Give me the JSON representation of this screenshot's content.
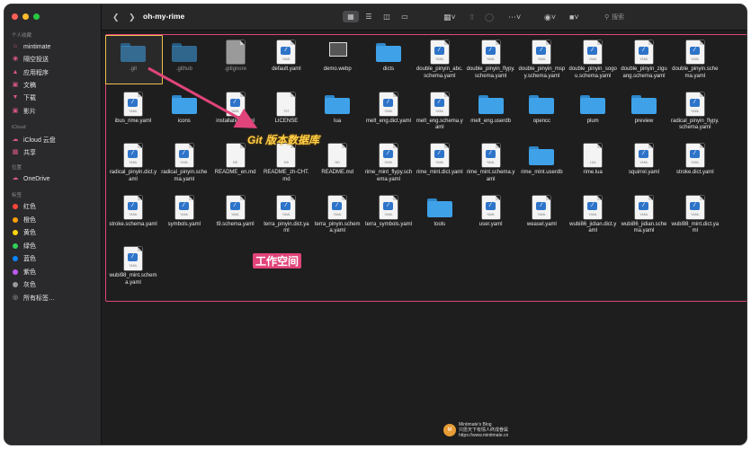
{
  "window": {
    "title": "oh-my-rime"
  },
  "toolbar": {
    "back_icon": "chevron-left",
    "forward_icon": "chevron-right",
    "search_placeholder": "搜索"
  },
  "sidebar": {
    "sections": {
      "personal": "个人收藏",
      "icloud": "iCloud",
      "locations": "位置",
      "tags": "标签"
    },
    "favorites": [
      {
        "label": "mintimate",
        "icon": "home-icon"
      },
      {
        "label": "隔空投送",
        "icon": "airdrop-icon"
      },
      {
        "label": "应用程序",
        "icon": "apps-icon"
      },
      {
        "label": "文稿",
        "icon": "document-icon"
      },
      {
        "label": "下载",
        "icon": "download-icon"
      },
      {
        "label": "影片",
        "icon": "movie-icon"
      }
    ],
    "icloud_items": [
      {
        "label": "iCloud 云盘",
        "icon": "cloud-icon"
      },
      {
        "label": "共享",
        "icon": "share-icon"
      }
    ],
    "location_items": [
      {
        "label": "OneDrive",
        "icon": "cloud-icon"
      }
    ],
    "tags": [
      {
        "label": "红色",
        "color": "#ff453a"
      },
      {
        "label": "橙色",
        "color": "#ff9f0a"
      },
      {
        "label": "黄色",
        "color": "#ffd60a"
      },
      {
        "label": "绿色",
        "color": "#30d158"
      },
      {
        "label": "蓝色",
        "color": "#0a84ff"
      },
      {
        "label": "紫色",
        "color": "#bf5af2"
      },
      {
        "label": "灰色",
        "color": "#98989d"
      },
      {
        "label": "所有标签…",
        "color": ""
      }
    ]
  },
  "files": [
    {
      "name": ".git",
      "type": "folder",
      "dim": true
    },
    {
      "name": ".github",
      "type": "folder",
      "dim": true
    },
    {
      "name": ".gitignore",
      "type": "doc",
      "dim": true,
      "ext": ""
    },
    {
      "name": "default.yaml",
      "type": "yaml"
    },
    {
      "name": "demo.webp",
      "type": "image"
    },
    {
      "name": "dicts",
      "type": "folder"
    },
    {
      "name": "double_pinyin_abc.schema.yaml",
      "type": "yaml"
    },
    {
      "name": "double_pinyin_flypy.schema.yaml",
      "type": "yaml"
    },
    {
      "name": "double_pinyin_mspy.schema.yaml",
      "type": "yaml"
    },
    {
      "name": "double_pinyin_sogou.schema.yaml",
      "type": "yaml"
    },
    {
      "name": "double_pinyin_ziguang.schema.yaml",
      "type": "yaml"
    },
    {
      "name": "double_pinyin.schema.yaml",
      "type": "yaml"
    },
    {
      "name": "ibus_rime.yaml",
      "type": "yaml"
    },
    {
      "name": "icons",
      "type": "folder"
    },
    {
      "name": "installation.yaml",
      "type": "yaml"
    },
    {
      "name": "LICENSE",
      "type": "txt",
      "ext": "TXT"
    },
    {
      "name": "lua",
      "type": "folder"
    },
    {
      "name": "melt_eng.dict.yaml",
      "type": "yaml"
    },
    {
      "name": "melt_eng.schema.yaml",
      "type": "yaml"
    },
    {
      "name": "melt_eng.userdb",
      "type": "folder"
    },
    {
      "name": "opencc",
      "type": "folder"
    },
    {
      "name": "plum",
      "type": "folder"
    },
    {
      "name": "preview",
      "type": "folder"
    },
    {
      "name": "radical_pinyin_flypy.schema.yaml",
      "type": "yaml"
    },
    {
      "name": "radical_pinyin.dict.yaml",
      "type": "yaml"
    },
    {
      "name": "radical_pinyin.schema.yaml",
      "type": "yaml"
    },
    {
      "name": "README_en.md",
      "type": "md",
      "ext": "MD"
    },
    {
      "name": "README_zh-CHT.md",
      "type": "md",
      "ext": "MD"
    },
    {
      "name": "README.md",
      "type": "md",
      "ext": "MD"
    },
    {
      "name": "rime_mint_flypy.schema.yaml",
      "type": "yaml"
    },
    {
      "name": "rime_mint.dict.yaml",
      "type": "yaml"
    },
    {
      "name": "rime_mint.schema.yaml",
      "type": "yaml"
    },
    {
      "name": "rime_mint.userdb",
      "type": "folder"
    },
    {
      "name": "rime.lua",
      "type": "lua",
      "ext": "LUA"
    },
    {
      "name": "squirrel.yaml",
      "type": "yaml"
    },
    {
      "name": "stroke.dict.yaml",
      "type": "yaml"
    },
    {
      "name": "stroke.schema.yaml",
      "type": "yaml"
    },
    {
      "name": "symbols.yaml",
      "type": "yaml"
    },
    {
      "name": "t9.schema.yaml",
      "type": "yaml"
    },
    {
      "name": "terra_pinyin.dict.yaml",
      "type": "yaml"
    },
    {
      "name": "terra_pinyin.schema.yaml",
      "type": "yaml"
    },
    {
      "name": "terra_symbols.yaml",
      "type": "yaml"
    },
    {
      "name": "tools",
      "type": "folder"
    },
    {
      "name": "user.yaml",
      "type": "yaml"
    },
    {
      "name": "weasel.yaml",
      "type": "yaml"
    },
    {
      "name": "wubi86_jidian.dict.yaml",
      "type": "yaml"
    },
    {
      "name": "wubi86_jidian.schema.yaml",
      "type": "yaml"
    },
    {
      "name": "wubi98_mint.dict.yaml",
      "type": "yaml"
    },
    {
      "name": "wubi98_mint.schema.yaml",
      "type": "yaml"
    }
  ],
  "annotations": {
    "git_repo": "Git 版本数据库",
    "workspace": "工作空间"
  },
  "watermark": {
    "logo": "M",
    "line1": "Mintimate's Blog",
    "line2": "只愿天下有情人终成眷属",
    "line3": "https://www.mintimate.cn"
  },
  "colors": {
    "folder": "#3fa2e8",
    "tag_box": "#e0447a",
    "git_box": "#f2c14e"
  }
}
